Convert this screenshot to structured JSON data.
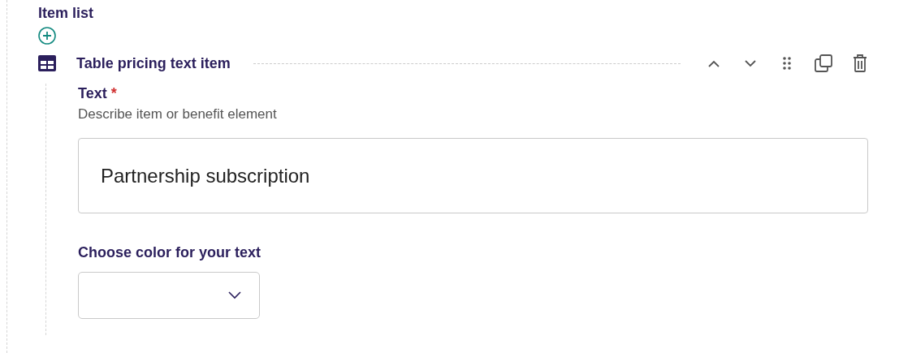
{
  "section": {
    "title": "Item list"
  },
  "item": {
    "title": "Table pricing text item",
    "fields": [
      {
        "kind": "text",
        "label": "Text",
        "required_mark": "*",
        "description": "Describe item or benefit element",
        "value": "Partnership subscription"
      },
      {
        "kind": "select",
        "label": "Choose color for your text"
      }
    ]
  }
}
